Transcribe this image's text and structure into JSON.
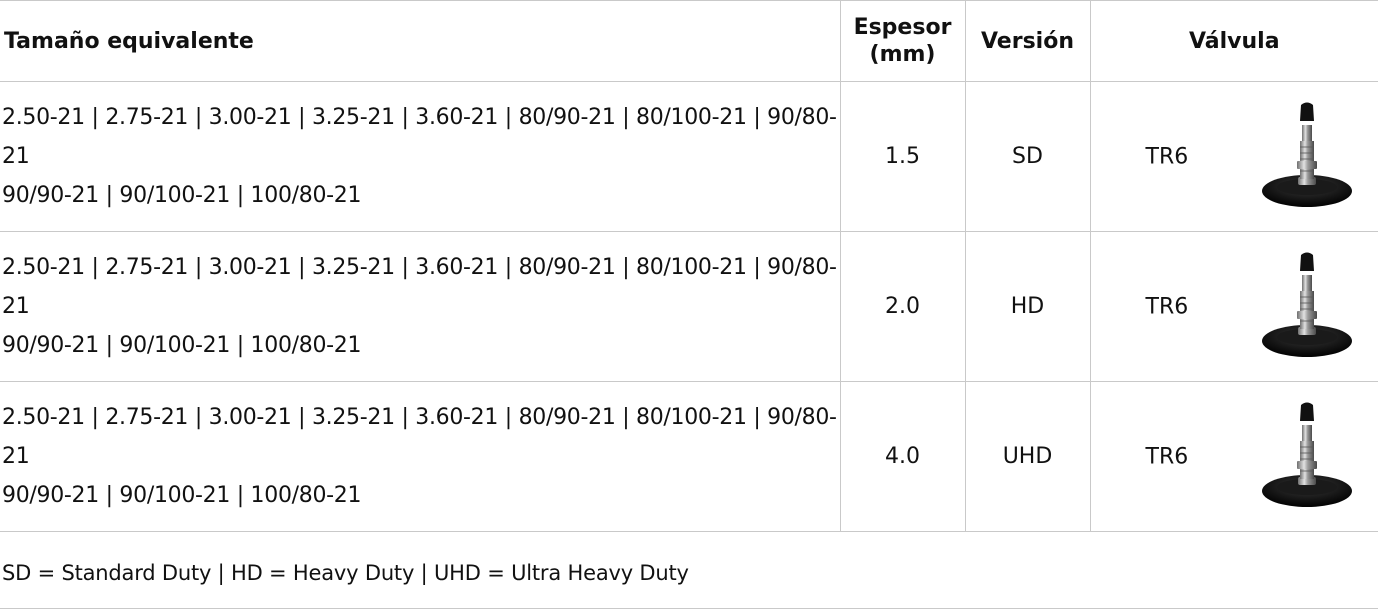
{
  "table": {
    "headers": {
      "size": "Tamaño equivalente",
      "thickness": "Espesor\n(mm)",
      "thickness_line1": "Espesor",
      "thickness_line2": "(mm)",
      "version": "Versión",
      "valve": "Válvula"
    },
    "rows": [
      {
        "sizes_line1": "2.50-21 | 2.75-21 | 3.00-21 | 3.25-21 | 3.60-21 | 80/90-21 | 80/100-21 | 90/80-21",
        "sizes_line2": "90/90-21 | 90/100-21 | 100/80-21",
        "thickness": "1.5",
        "version": "SD",
        "valve": "TR6",
        "valve_icon": "tr6-valve-icon"
      },
      {
        "sizes_line1": "2.50-21 | 2.75-21 | 3.00-21 | 3.25-21 | 3.60-21 | 80/90-21 | 80/100-21 | 90/80-21",
        "sizes_line2": "90/90-21 | 90/100-21 | 100/80-21",
        "thickness": "2.0",
        "version": "HD",
        "valve": "TR6",
        "valve_icon": "tr6-valve-icon"
      },
      {
        "sizes_line1": "2.50-21 | 2.75-21 | 3.00-21 | 3.25-21 | 3.60-21 | 80/90-21 | 80/100-21 | 90/80-21",
        "sizes_line2": "90/90-21 | 90/100-21 | 100/80-21",
        "thickness": "4.0",
        "version": "UHD",
        "valve": "TR6",
        "valve_icon": "tr6-valve-icon"
      }
    ]
  },
  "legend": "SD = Standard Duty | HD = Heavy Duty | UHD = Ultra Heavy Duty",
  "colors": {
    "text": "#111111",
    "rule": "#c9c9c9",
    "background": "#ffffff"
  }
}
